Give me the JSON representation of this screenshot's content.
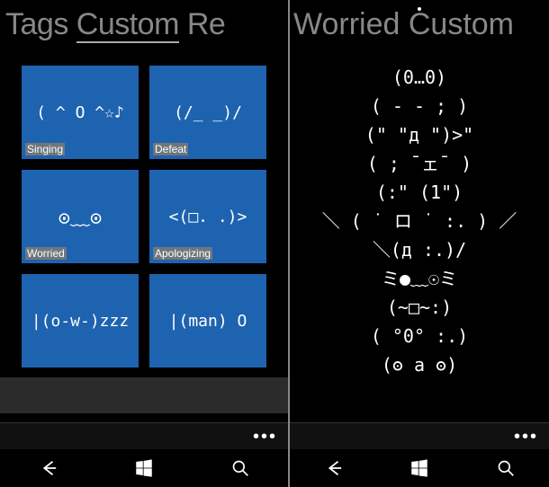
{
  "left": {
    "header_parts": [
      "Tags ",
      "Custom",
      " Re"
    ],
    "tiles": [
      {
        "emoticon": "( ^ O ^☆♪",
        "label": "Singing"
      },
      {
        "emoticon": "(/_ _)/",
        "label": "Defeat"
      },
      {
        "emoticon": "⊙﹏⊙",
        "label": "Worried"
      },
      {
        "emoticon": "<(□. .)>",
        "label": "Apologizing"
      },
      {
        "emoticon": "|(o-w-)zzz",
        "label": ""
      },
      {
        "emoticon": "|(man) O",
        "label": ""
      }
    ]
  },
  "right": {
    "header_parts": [
      "Worried",
      " Custom"
    ],
    "list": [
      "(0…0)",
      "( -  - ; )",
      "(\" \"д \")>\"",
      "( ;  ¯ェ¯ )",
      "(:\" (1\")",
      "＼ (  ˙ ロ ˙ :. ) ／",
      "＼(д :.)/",
      "ミ●﹏☉ミ",
      "(~□~:)",
      "(  °0° :.)",
      "(ʘ a ʘ)"
    ]
  },
  "nav": {
    "more": "•••",
    "back": "back-icon",
    "start": "windows-icon",
    "search": "search-icon"
  }
}
